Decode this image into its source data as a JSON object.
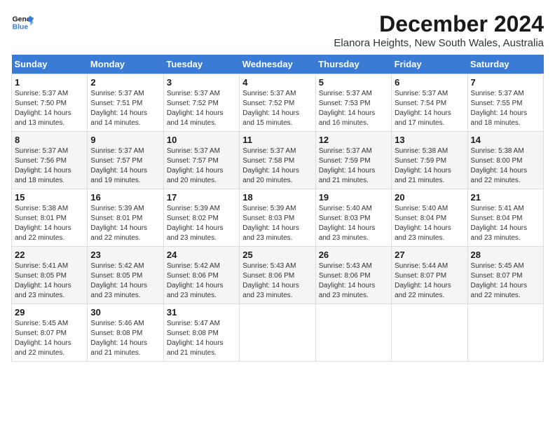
{
  "logo": {
    "line1": "General",
    "line2": "Blue"
  },
  "title": "December 2024",
  "subtitle": "Elanora Heights, New South Wales, Australia",
  "weekdays": [
    "Sunday",
    "Monday",
    "Tuesday",
    "Wednesday",
    "Thursday",
    "Friday",
    "Saturday"
  ],
  "weeks": [
    [
      {
        "day": "1",
        "sunrise": "5:37 AM",
        "sunset": "7:50 PM",
        "daylight": "14 hours and 13 minutes."
      },
      {
        "day": "2",
        "sunrise": "5:37 AM",
        "sunset": "7:51 PM",
        "daylight": "14 hours and 14 minutes."
      },
      {
        "day": "3",
        "sunrise": "5:37 AM",
        "sunset": "7:52 PM",
        "daylight": "14 hours and 14 minutes."
      },
      {
        "day": "4",
        "sunrise": "5:37 AM",
        "sunset": "7:52 PM",
        "daylight": "14 hours and 15 minutes."
      },
      {
        "day": "5",
        "sunrise": "5:37 AM",
        "sunset": "7:53 PM",
        "daylight": "14 hours and 16 minutes."
      },
      {
        "day": "6",
        "sunrise": "5:37 AM",
        "sunset": "7:54 PM",
        "daylight": "14 hours and 17 minutes."
      },
      {
        "day": "7",
        "sunrise": "5:37 AM",
        "sunset": "7:55 PM",
        "daylight": "14 hours and 18 minutes."
      }
    ],
    [
      {
        "day": "8",
        "sunrise": "5:37 AM",
        "sunset": "7:56 PM",
        "daylight": "14 hours and 18 minutes."
      },
      {
        "day": "9",
        "sunrise": "5:37 AM",
        "sunset": "7:57 PM",
        "daylight": "14 hours and 19 minutes."
      },
      {
        "day": "10",
        "sunrise": "5:37 AM",
        "sunset": "7:57 PM",
        "daylight": "14 hours and 20 minutes."
      },
      {
        "day": "11",
        "sunrise": "5:37 AM",
        "sunset": "7:58 PM",
        "daylight": "14 hours and 20 minutes."
      },
      {
        "day": "12",
        "sunrise": "5:37 AM",
        "sunset": "7:59 PM",
        "daylight": "14 hours and 21 minutes."
      },
      {
        "day": "13",
        "sunrise": "5:38 AM",
        "sunset": "7:59 PM",
        "daylight": "14 hours and 21 minutes."
      },
      {
        "day": "14",
        "sunrise": "5:38 AM",
        "sunset": "8:00 PM",
        "daylight": "14 hours and 22 minutes."
      }
    ],
    [
      {
        "day": "15",
        "sunrise": "5:38 AM",
        "sunset": "8:01 PM",
        "daylight": "14 hours and 22 minutes."
      },
      {
        "day": "16",
        "sunrise": "5:39 AM",
        "sunset": "8:01 PM",
        "daylight": "14 hours and 22 minutes."
      },
      {
        "day": "17",
        "sunrise": "5:39 AM",
        "sunset": "8:02 PM",
        "daylight": "14 hours and 23 minutes."
      },
      {
        "day": "18",
        "sunrise": "5:39 AM",
        "sunset": "8:03 PM",
        "daylight": "14 hours and 23 minutes."
      },
      {
        "day": "19",
        "sunrise": "5:40 AM",
        "sunset": "8:03 PM",
        "daylight": "14 hours and 23 minutes."
      },
      {
        "day": "20",
        "sunrise": "5:40 AM",
        "sunset": "8:04 PM",
        "daylight": "14 hours and 23 minutes."
      },
      {
        "day": "21",
        "sunrise": "5:41 AM",
        "sunset": "8:04 PM",
        "daylight": "14 hours and 23 minutes."
      }
    ],
    [
      {
        "day": "22",
        "sunrise": "5:41 AM",
        "sunset": "8:05 PM",
        "daylight": "14 hours and 23 minutes."
      },
      {
        "day": "23",
        "sunrise": "5:42 AM",
        "sunset": "8:05 PM",
        "daylight": "14 hours and 23 minutes."
      },
      {
        "day": "24",
        "sunrise": "5:42 AM",
        "sunset": "8:06 PM",
        "daylight": "14 hours and 23 minutes."
      },
      {
        "day": "25",
        "sunrise": "5:43 AM",
        "sunset": "8:06 PM",
        "daylight": "14 hours and 23 minutes."
      },
      {
        "day": "26",
        "sunrise": "5:43 AM",
        "sunset": "8:06 PM",
        "daylight": "14 hours and 23 minutes."
      },
      {
        "day": "27",
        "sunrise": "5:44 AM",
        "sunset": "8:07 PM",
        "daylight": "14 hours and 22 minutes."
      },
      {
        "day": "28",
        "sunrise": "5:45 AM",
        "sunset": "8:07 PM",
        "daylight": "14 hours and 22 minutes."
      }
    ],
    [
      {
        "day": "29",
        "sunrise": "5:45 AM",
        "sunset": "8:07 PM",
        "daylight": "14 hours and 22 minutes."
      },
      {
        "day": "30",
        "sunrise": "5:46 AM",
        "sunset": "8:08 PM",
        "daylight": "14 hours and 21 minutes."
      },
      {
        "day": "31",
        "sunrise": "5:47 AM",
        "sunset": "8:08 PM",
        "daylight": "14 hours and 21 minutes."
      },
      null,
      null,
      null,
      null
    ]
  ]
}
